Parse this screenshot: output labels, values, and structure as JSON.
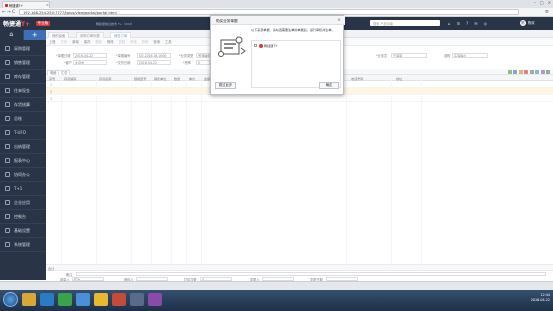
{
  "browser": {
    "tab_title": "畅捷通T+",
    "url": "192.168.254.250:7777/tplus/view/portal/portal.html",
    "close": "×",
    "window_controls": [
      "–",
      "□",
      "×"
    ],
    "nav_back": "←",
    "nav_forward": "→",
    "nav_reload": "C",
    "nav_home": "⌂",
    "menu_icon": "≡"
  },
  "app": {
    "logo_main": "畅捷通",
    "logo_accent": "T+",
    "system_name": "专业版",
    "company": "畅捷通信息技术 T+（202）",
    "search_placeholder": "搜索 产品功能",
    "header_icons": [
      "⌂",
      "☰",
      "?",
      "✉",
      "◎"
    ],
    "user_initial": "陈",
    "user_name": "陈欢"
  },
  "sidebar": {
    "home_icon": "⌂",
    "add_icon": "+",
    "items": [
      {
        "label": "采购管理"
      },
      {
        "label": "销售管理"
      },
      {
        "label": "库存管理"
      },
      {
        "label": "往来现金"
      },
      {
        "label": "存货核算"
      },
      {
        "label": "总账"
      },
      {
        "label": "T-UFO"
      },
      {
        "label": "出纳管理"
      },
      {
        "label": "报表中心"
      },
      {
        "label": "协同办公"
      },
      {
        "label": "T+1"
      },
      {
        "label": "企业应用"
      },
      {
        "label": "控制台"
      },
      {
        "label": "基础设置"
      },
      {
        "label": "系统管理"
      }
    ]
  },
  "content_tabs": [
    {
      "label": "我的桌面"
    },
    {
      "label": "采购订单列表"
    },
    {
      "label": "销售订单"
    }
  ],
  "toolbar": [
    "上账",
    "打印",
    "新增",
    "保存",
    "删除",
    "修改",
    "复制",
    "审核",
    "弃审",
    "查询",
    "工具"
  ],
  "form": {
    "bill_date_label": "单据日期",
    "bill_date": "2016-04-22",
    "bill_no_label": "单据编号",
    "bill_no": "SO-2016-04-0005",
    "business_type_label": "业务类型",
    "business_type": "普通销售",
    "customer_label": "客户",
    "customer": "北京市",
    "department_label": "部门",
    "department": "销售部",
    "salesman_label": "业务员",
    "salesman": "王莉莉",
    "customer2_label": "选购",
    "customer2": "东强客户",
    "invoice_label": "仓库",
    "invoice": "总仓库",
    "delivery_label": "交货日期",
    "delivery": "2016-04-22",
    "tax_label": "税率",
    "tax": "0"
  },
  "grid": {
    "tabs": [
      "明细",
      "汇总"
    ],
    "headers": [
      "序号",
      "存货编码",
      "存货名称",
      "规格型号",
      "销售单位",
      "数量",
      "单价",
      "金额",
      "税额",
      "含税金额",
      "备注",
      "报价",
      "电话号码",
      "地址"
    ],
    "rows": [
      "1",
      "2",
      "3"
    ],
    "sum_label": "合计"
  },
  "footer": {
    "note_label": "备注",
    "fields": [
      "制单人",
      "审核人",
      "打印次数",
      "变更人",
      "变更日期"
    ],
    "maker": "陈欢",
    "print_times": "0"
  },
  "modal": {
    "title": "购买业务单据",
    "close": "×",
    "description": "以下来源单据，请勾选需要生单的单据后，进行审核并生单。",
    "item": "畅捷通T+",
    "skip_button": "跳过此步",
    "ok_button": "确定"
  },
  "taskbar": {
    "time": "12:44",
    "date": "2016-04-22"
  }
}
